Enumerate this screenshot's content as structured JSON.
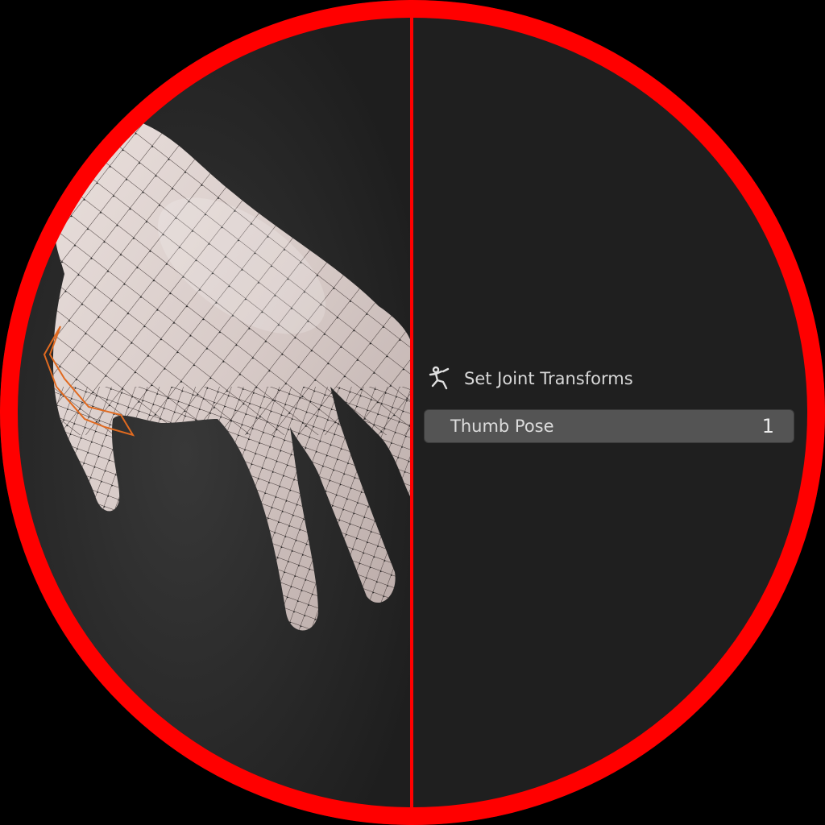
{
  "viewport": {
    "object": "hand mesh",
    "background_color": "#2b2b2b",
    "mesh_color": "#d8ccc8",
    "selection_color": "#ff7a1a"
  },
  "operator_panel": {
    "icon": "armature-pose-icon",
    "title": "Set Joint Transforms",
    "fields": [
      {
        "label": "Thumb Pose",
        "value": "1"
      }
    ]
  },
  "highlight": {
    "ring_color": "#ff0000"
  }
}
